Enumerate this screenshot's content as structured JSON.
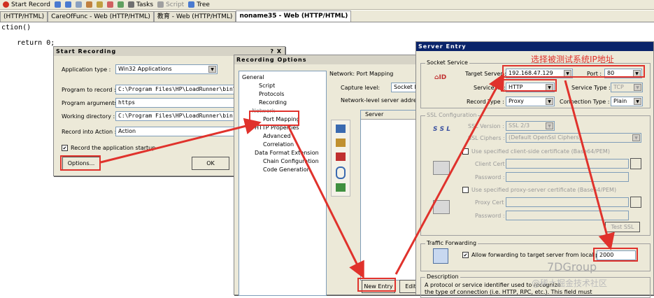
{
  "toolbar": {
    "start_record": "Start Record",
    "tasks": "Tasks",
    "script": "Script",
    "tree": "Tree"
  },
  "tabs": [
    {
      "label": "(HTTP/HTML)"
    },
    {
      "label": "CareOfFunc - Web (HTTP/HTML)"
    },
    {
      "label": "教育 - Web (HTTP/HTML)"
    },
    {
      "label": "noname35 - Web (HTTP/HTML)"
    }
  ],
  "code": {
    "line1": "ction()",
    "line2": "    return 0;"
  },
  "start_recording": {
    "title": "Start Recording",
    "title_controls": "? X",
    "application_type_label": "Application type :",
    "application_type_value": "Win32 Applications",
    "program_label": "Program to record :",
    "program_value": "C:\\Program Files\\HP\\LoadRunner\\bin\\vg",
    "args_label": "Program arguments :",
    "args_value": "https",
    "workdir_label": "Working directory :",
    "workdir_value": "C:\\Program Files\\HP\\LoadRunner\\bin",
    "action_label": "Record into Action :",
    "action_value": "Action",
    "record_startup_label": "Record the application startup",
    "options_button": "Options...",
    "ok_button": "OK"
  },
  "recording_options": {
    "title": "Recording Options",
    "tree": {
      "general": "General",
      "script": "Script",
      "protocols": "Protocols",
      "recording": "Recording",
      "network": "Network",
      "port_mapping": "Port Mapping",
      "http_properties": "HTTP Properties",
      "advanced": "Advanced",
      "correlation": "Correlation",
      "data_format": "Data Format Extension",
      "chain_config": "Chain Configuration",
      "code_generation": "Code Generation"
    },
    "section_title": "Network: Port Mapping",
    "capture_level_label": "Capture level:",
    "capture_level_value": "Socket le",
    "network_desc": "Network-level server address m",
    "server_col": "Server",
    "new_entry_button": "New Entry",
    "edit_button": "Edit"
  },
  "server_entry": {
    "title": "Server Entry",
    "annotation": "选择被测试系统IP地址",
    "socket_service": "Socket Service",
    "target_server_label": "Target Server :",
    "target_server_value": "192.168.47.129",
    "port_label": "Port :",
    "port_value": "80",
    "service_id_label": "Service ID :",
    "service_id_value": "HTTP",
    "service_type_label": "Service Type :",
    "service_type_value": "TCP",
    "record_type_label": "Record Type :",
    "record_type_value": "Proxy",
    "connection_type_label": "Connection Type :",
    "connection_type_value": "Plain",
    "ssl_config": "SSL Configuration",
    "ssl_version_label": "SSL Version :",
    "ssl_version_value": "SSL 2/3",
    "ssl_ciphers_label": "SSL Ciphers :",
    "ssl_ciphers_value": "(Default OpenSsl Ciphers)",
    "client_cert_check": "Use specified client-side certificate (Base64/PEM)",
    "client_cert_label": "Client Cert :",
    "password_label": "Password :",
    "proxy_cert_check": "Use specified proxy-server certificate (Base64/PEM)",
    "proxy_cert_label": "Proxy Cert :",
    "password2_label": "Password :",
    "test_ssl_button": "Test SSL",
    "traffic_forwarding": "Traffic Forwarding",
    "forwarding_label": "Allow forwarding to target server from local port :",
    "forwarding_port": "2000",
    "description_label": "Description",
    "description_text1": "A protocol or service identifier used to recognize",
    "description_text2": "the type of connection (i.e. HTTP, RPC, etc.). This field must",
    "ssl_icon_text": "S S L"
  },
  "watermark": {
    "brand": "7DGroup",
    "sub": "@稀土掘金技术社区"
  },
  "colors": {
    "annotation_red": "#e0322c",
    "dialog_bg": "#ece9d8",
    "title_blue": "#0a246a"
  }
}
